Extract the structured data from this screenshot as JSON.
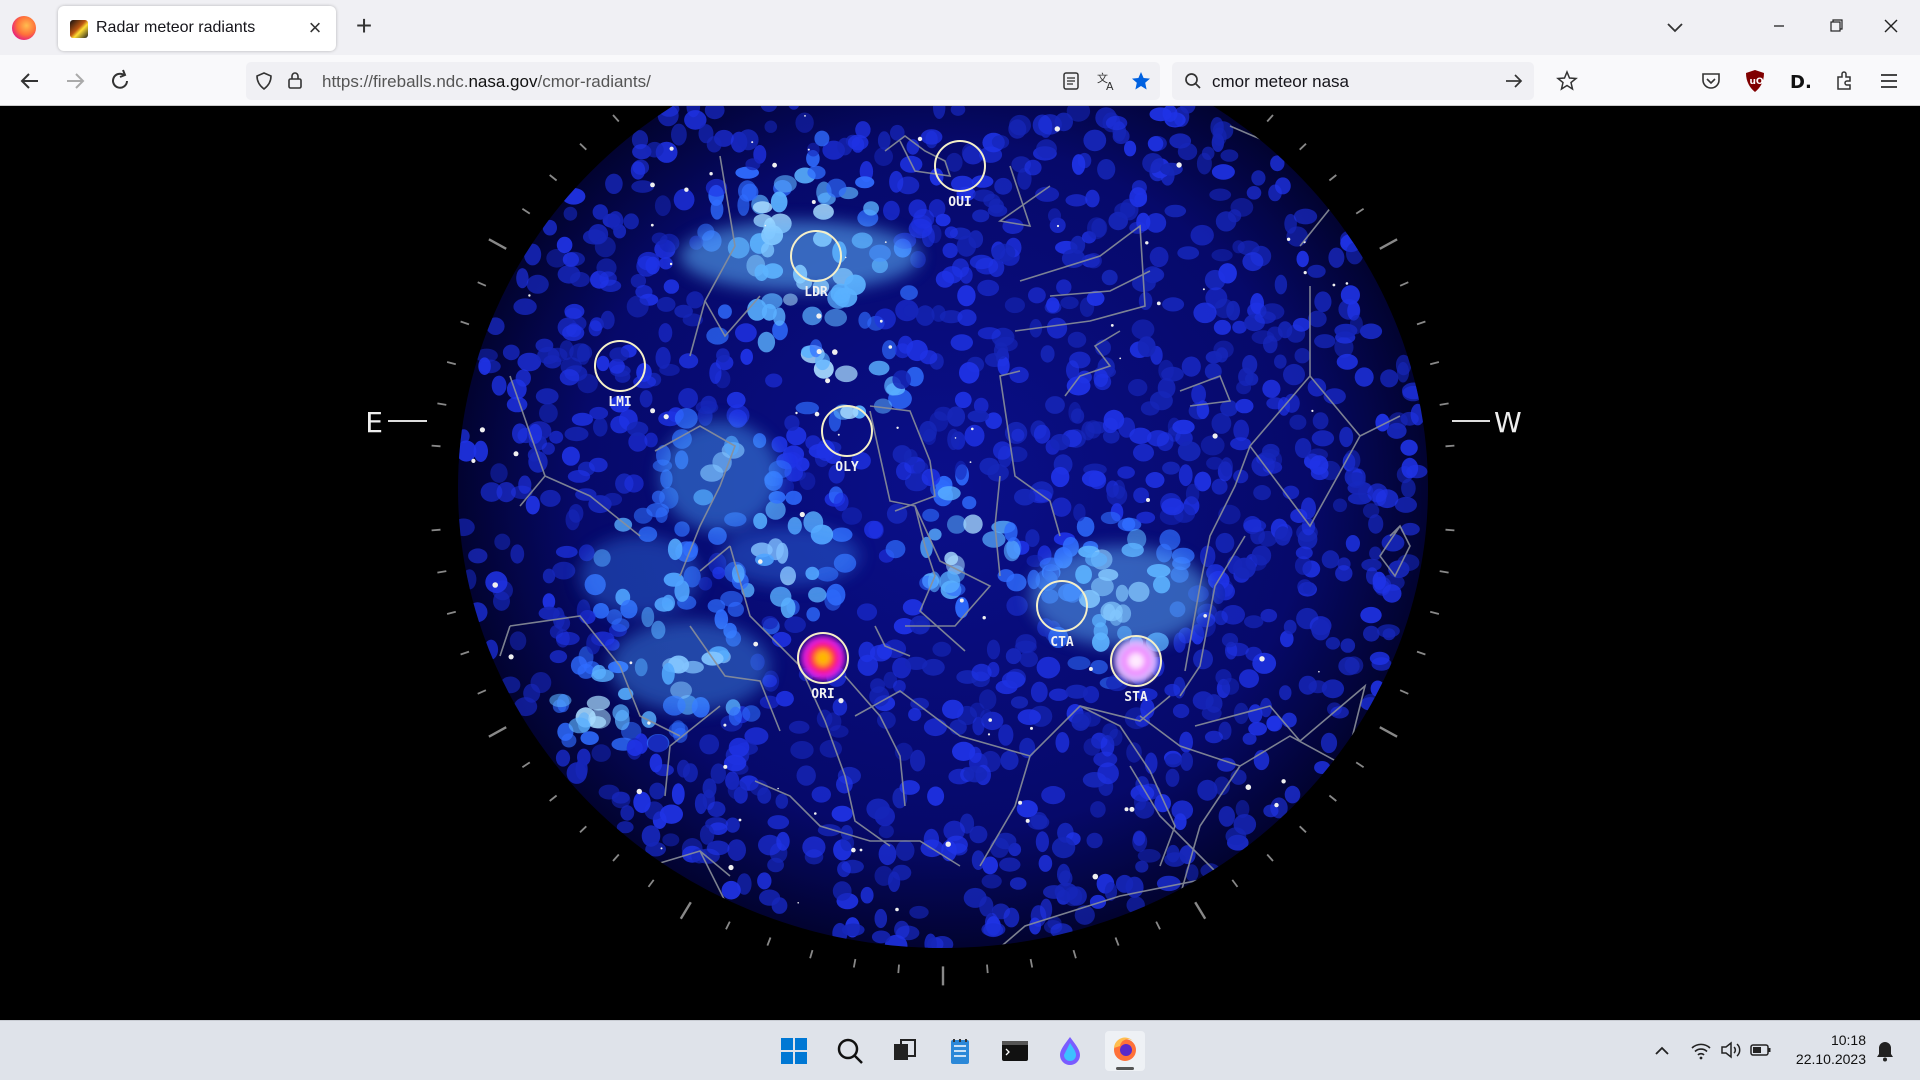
{
  "browser": {
    "tab": {
      "title": "Radar meteor radiants"
    },
    "url": {
      "scheme": "https://fireballs.ndc.",
      "host": "nasa.gov",
      "path": "/cmor-radiants/"
    },
    "search": {
      "value": "cmor meteor nasa"
    }
  },
  "sky": {
    "compass": {
      "east": "E",
      "west": "W"
    },
    "showers": [
      {
        "code": "OUI",
        "highlight": false
      },
      {
        "code": "LDR",
        "highlight": false
      },
      {
        "code": "LMI",
        "highlight": false
      },
      {
        "code": "OLY",
        "highlight": false
      },
      {
        "code": "CTA",
        "highlight": false
      },
      {
        "code": "ORI",
        "highlight": true
      },
      {
        "code": "STA",
        "highlight": true
      }
    ]
  },
  "taskbar": {
    "apps": [
      "start-icon",
      "search-icon",
      "task-view-icon",
      "notepad-icon",
      "terminal-icon",
      "edge-dev-icon",
      "firefox-icon"
    ],
    "time": "10:18",
    "date": "22.10.2023"
  },
  "colors": {
    "heat_blue": "#1a2bd8",
    "heat_cyan": "#9fdcff",
    "heat_red": "#ff2a2a",
    "circle": "#f5f0c8"
  }
}
